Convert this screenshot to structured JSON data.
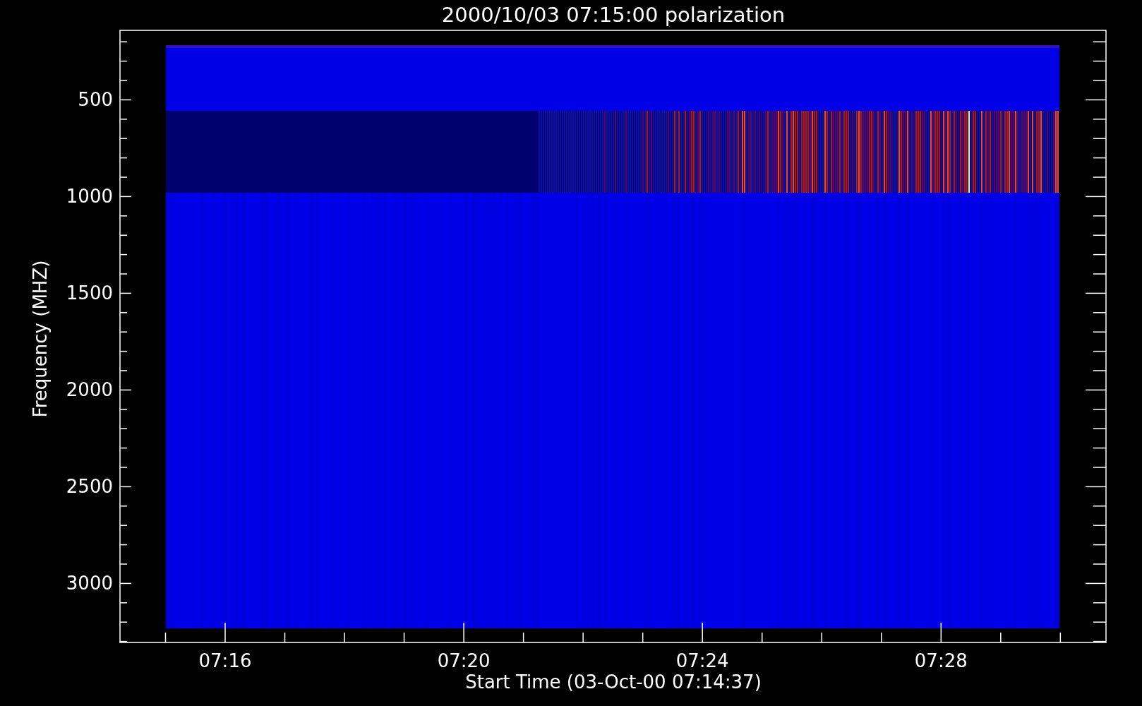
{
  "plot": {
    "title": "2000/10/03 07:15:00 polarization",
    "ylabel": "Frequency (MHZ)",
    "xlabel": "Start Time (03-Oct-00 07:14:37)",
    "yticks": [
      "500",
      "1000",
      "1500",
      "2000",
      "2500",
      "3000"
    ],
    "xticks": [
      "07:16",
      "07:20",
      "07:24",
      "07:28"
    ]
  }
}
